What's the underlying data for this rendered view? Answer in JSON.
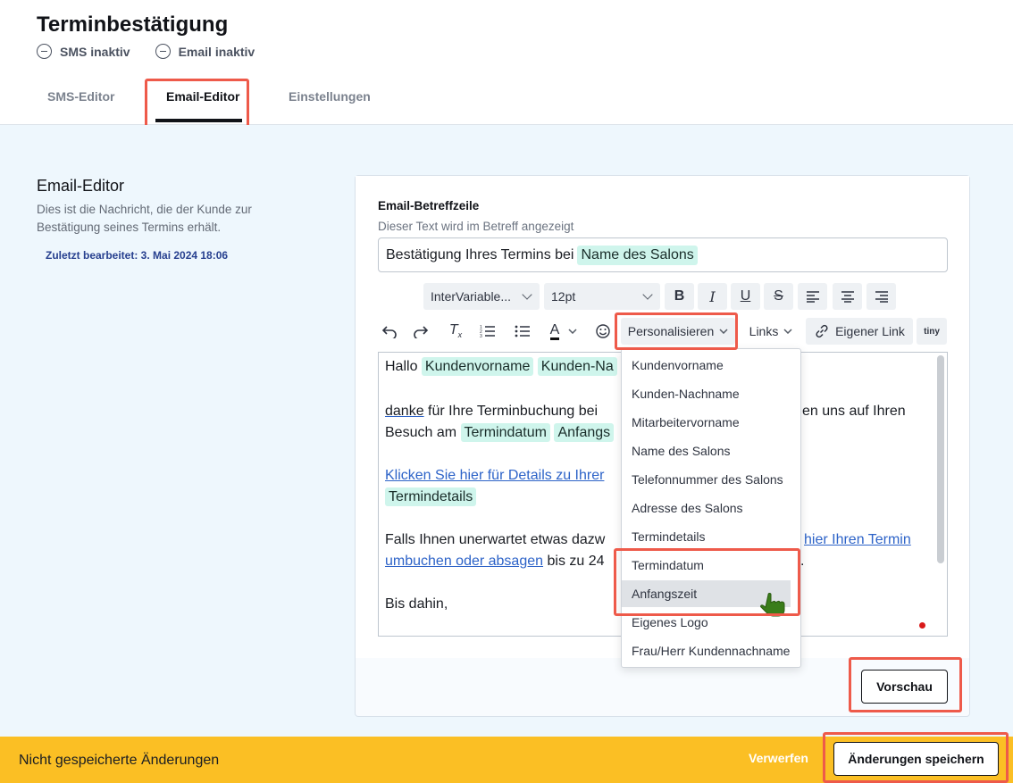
{
  "header": {
    "title": "Terminbestätigung",
    "sms_status": "SMS inaktiv",
    "email_status": "Email inaktiv",
    "tabs": [
      {
        "label": "SMS-Editor",
        "active": false
      },
      {
        "label": "Email-Editor",
        "active": true
      },
      {
        "label": "Einstellungen",
        "active": false
      }
    ]
  },
  "sidebar": {
    "title": "Email-Editor",
    "description": "Dies ist die Nachricht, die der Kunde zur Bestätigung seines Termins erhält.",
    "last_edited": "Zuletzt bearbeitet: 3. Mai 2024 18:06"
  },
  "subject": {
    "label": "Email-Betreffzeile",
    "hint": "Dieser Text wird im Betreff angezeigt",
    "text": "Bestätigung Ihres Termins bei",
    "tag": "Name des Salons"
  },
  "toolbar": {
    "font": "InterVariable...",
    "size": "12pt",
    "personalize": "Personalisieren",
    "links": "Links",
    "own_link": "Eigener Link",
    "tiny": "tiny",
    "text_color": "A"
  },
  "editor": {
    "line1_text": "Hallo",
    "tag_first_name": "Kundenvorname",
    "tag_last_name": "Kunden-Na",
    "line2_word": "danke",
    "line2_rest": "für Ihre Terminbuchung bei",
    "line2_tail": "en uns auf Ihren",
    "line3_text": "Besuch am",
    "tag_date": "Termindatum",
    "tag_start": "Anfangs",
    "link_details": "Klicken Sie hier für Details zu Ihrer",
    "tag_details": "Termindetails",
    "line5_start": "Falls Ihnen unerwartet etwas dazw",
    "link_rebook_tail": "hier Ihren Termin",
    "link_rebook": "umbuchen oder absagen",
    "line6_rest": "bis zu 24",
    "line6_end": ".",
    "closing": "Bis dahin,"
  },
  "dropdown": {
    "items": [
      "Kundenvorname",
      "Kunden-Nachname",
      "Mitarbeitervorname",
      "Name des Salons",
      "Telefonnummer des Salons",
      "Adresse des Salons",
      "Termindetails",
      "Termindatum",
      "Anfangszeit",
      "Eigenes Logo",
      "Frau/Herr Kundennachname"
    ],
    "hovered": "Anfangszeit"
  },
  "actions": {
    "preview": "Vorschau",
    "footer_message": "Nicht gespeicherte Änderungen",
    "discard": "Verwerfen",
    "save": "Änderungen speichern"
  },
  "colors": {
    "accent_highlight": "#ee5a4a",
    "footer_bg": "#fbbf24",
    "tag_bg": "#cff5ec",
    "link": "#2d63c8"
  }
}
